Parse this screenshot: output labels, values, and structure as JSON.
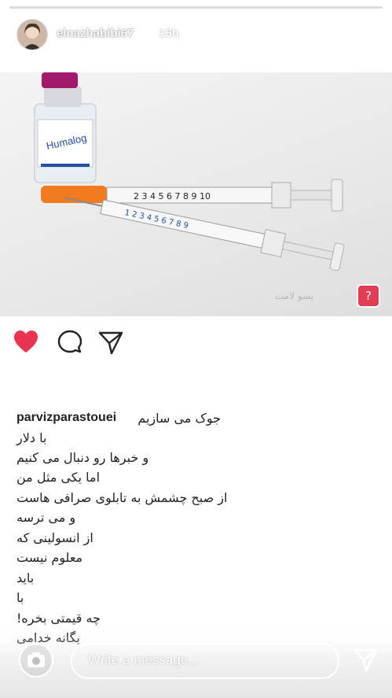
{
  "story": {
    "username": "elnazhabibi67",
    "time": "15h"
  },
  "post": {
    "bottle_label": "Humalog",
    "syringe_marks": [
      "2",
      "3",
      "4",
      "5",
      "6",
      "7",
      "8",
      "9",
      "10"
    ],
    "watermark_text": "یسو لامت"
  },
  "actions": {
    "liked": true
  },
  "caption": {
    "author": "parvizparastouei",
    "lines": [
      "جوک می سازیم",
      "با  دلار",
      "و خبرها رو دنبال می کنیم",
      "اما یکی مثل من",
      "از صبح چشمش به تابلوی صرافی هاست",
      "و می ترسه",
      "از انسولینی که",
      "معلوم نیست",
      "باید",
      "با",
      "چه قیمتی بخره!",
      "یگانه خدامی"
    ]
  },
  "reply": {
    "placeholder": "Write a message..."
  },
  "colors": {
    "like": "#e8344f",
    "syringe_cap": "#f47a20",
    "bottle_cap": "#a0196b"
  }
}
